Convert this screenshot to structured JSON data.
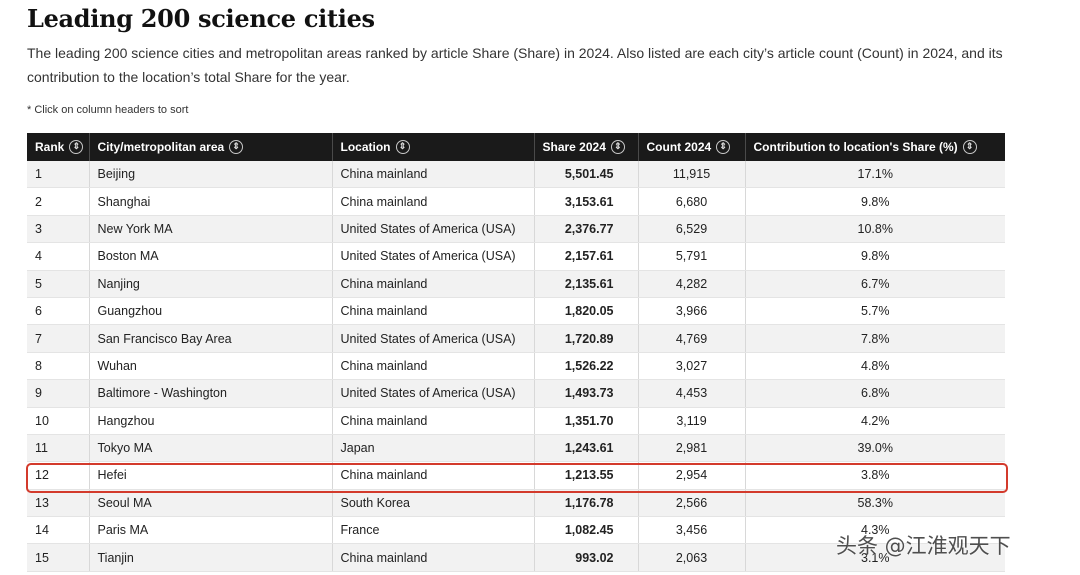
{
  "page": {
    "title": "Leading 200 science cities",
    "description": "The leading 200 science cities and metropolitan areas ranked by article Share (Share) in 2024. Also listed are each city’s article count (Count) in 2024, and its contribution to the location’s total Share for the year.",
    "hint": "* Click on column headers to sort"
  },
  "table": {
    "headers": [
      "Rank",
      "City/metropolitan area",
      "Location",
      "Share 2024",
      "Count 2024",
      "Contribution to location's Share (%)"
    ],
    "sort_icon": "sort-icon",
    "rows": [
      [
        "1",
        "Beijing",
        "China mainland",
        "5,501.45",
        "11,915",
        "17.1%"
      ],
      [
        "2",
        "Shanghai",
        "China mainland",
        "3,153.61",
        "6,680",
        "9.8%"
      ],
      [
        "3",
        "New York MA",
        "United States of America (USA)",
        "2,376.77",
        "6,529",
        "10.8%"
      ],
      [
        "4",
        "Boston MA",
        "United States of America (USA)",
        "2,157.61",
        "5,791",
        "9.8%"
      ],
      [
        "5",
        "Nanjing",
        "China mainland",
        "2,135.61",
        "4,282",
        "6.7%"
      ],
      [
        "6",
        "Guangzhou",
        "China mainland",
        "1,820.05",
        "3,966",
        "5.7%"
      ],
      [
        "7",
        "San Francisco Bay Area",
        "United States of America (USA)",
        "1,720.89",
        "4,769",
        "7.8%"
      ],
      [
        "8",
        "Wuhan",
        "China mainland",
        "1,526.22",
        "3,027",
        "4.8%"
      ],
      [
        "9",
        "Baltimore - Washington",
        "United States of America (USA)",
        "1,493.73",
        "4,453",
        "6.8%"
      ],
      [
        "10",
        "Hangzhou",
        "China mainland",
        "1,351.70",
        "3,119",
        "4.2%"
      ],
      [
        "11",
        "Tokyo MA",
        "Japan",
        "1,243.61",
        "2,981",
        "39.0%"
      ],
      [
        "12",
        "Hefei",
        "China mainland",
        "1,213.55",
        "2,954",
        "3.8%"
      ],
      [
        "13",
        "Seoul MA",
        "South Korea",
        "1,176.78",
        "2,566",
        "58.3%"
      ],
      [
        "14",
        "Paris MA",
        "France",
        "1,082.45",
        "3,456",
        "4.3%"
      ],
      [
        "15",
        "Tianjin",
        "China mainland",
        "993.02",
        "2,063",
        "3.1%"
      ]
    ],
    "highlighted_rank": "12",
    "highlight_color": "#d33a2c",
    "header_bg": "#1a1a1a"
  },
  "watermark": "头条 @江淮观天下"
}
